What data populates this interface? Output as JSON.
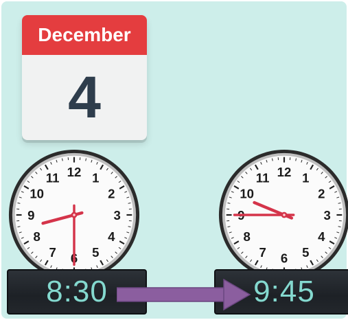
{
  "calendar": {
    "month": "December",
    "day": "4"
  },
  "clocks": [
    {
      "id": "start",
      "hour": 8,
      "minute": 30,
      "digital": "8:30"
    },
    {
      "id": "end",
      "hour": 9,
      "minute": 45,
      "digital": "9:45"
    }
  ],
  "dial_numbers": [
    "12",
    "1",
    "2",
    "3",
    "4",
    "5",
    "6",
    "7",
    "8",
    "9",
    "10",
    "11"
  ],
  "colors": {
    "background": "#cdeeea",
    "calendar_header": "#e43d3f",
    "hands": "#d4344a",
    "digital_text": "#84d9cf",
    "arrow": "#8b5e9f"
  }
}
